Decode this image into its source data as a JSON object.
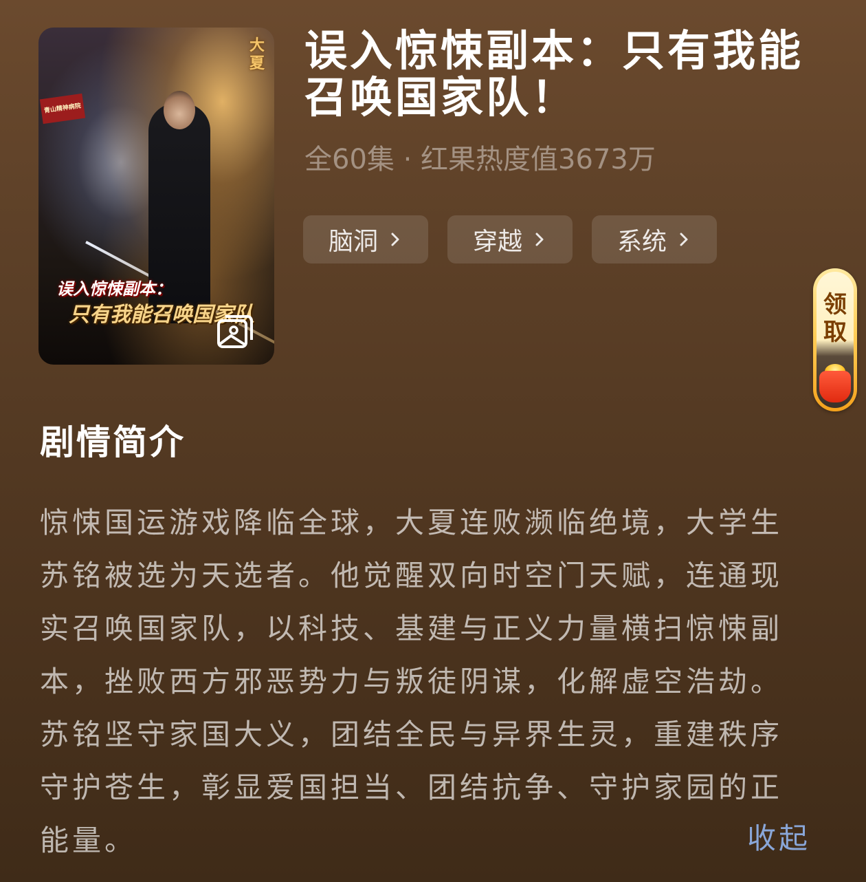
{
  "drama": {
    "title": "误入惊悚副本：只有我能召唤国家队！",
    "meta": "全60集 · 红果热度值3673万",
    "tags": [
      {
        "label": "脑洞"
      },
      {
        "label": "穿越"
      },
      {
        "label": "系统"
      }
    ]
  },
  "cover": {
    "title_line1": "误入惊悚副本：",
    "title_line2": "只有我能召唤国家队",
    "corner_text": "大夏",
    "sign_text": "青山精神病院",
    "overlay_icon": "image-gallery-icon"
  },
  "reward": {
    "label": "领取",
    "icon": "red-envelope-icon"
  },
  "synopsis": {
    "heading": "剧情简介",
    "text": "惊悚国运游戏降临全球，大夏连败濒临绝境，大学生苏铭被选为天选者。他觉醒双向时空门天赋，连通现实召唤国家队，以科技、基建与正义力量横扫惊悚副本，挫败西方邪恶势力与叛徒阴谋，化解虚空浩劫。苏铭坚守家国大义，团结全民与异界生灵，重建秩序守护苍生，彰显爱国担当、团结抗争、守护家园的正能量。",
    "collapse_label": "收起"
  },
  "colors": {
    "background_top": "#6b4a2e",
    "background_bottom": "#3f2b18",
    "link": "#89a6d8",
    "reward_gold": "#ffcf5a"
  }
}
